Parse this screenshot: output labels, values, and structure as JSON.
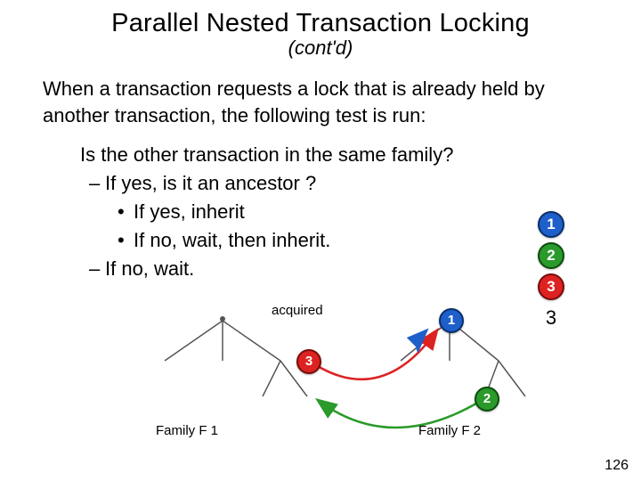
{
  "title": "Parallel Nested Transaction Locking",
  "subtitle": "(cont'd)",
  "intro": "When a transaction requests a lock that is already held by another transaction, the following test is run:",
  "question": "Is the other transaction in the same family?",
  "line_if_yes": "If yes, is it an ancestor ?",
  "line_inherit": "If yes, inherit",
  "line_wait_inherit": "If no, wait, then inherit.",
  "line_if_no": "If no, wait.",
  "acquired_label": "acquired",
  "side_nums": {
    "n1": "1",
    "n2": "2",
    "n3_badge": "3",
    "n3_plain": "3"
  },
  "diagram": {
    "f1_node3": "3",
    "f2_node1": "1",
    "f2_node2": "2",
    "family1": "Family F 1",
    "family2": "Family F 2"
  },
  "page_number": "126"
}
